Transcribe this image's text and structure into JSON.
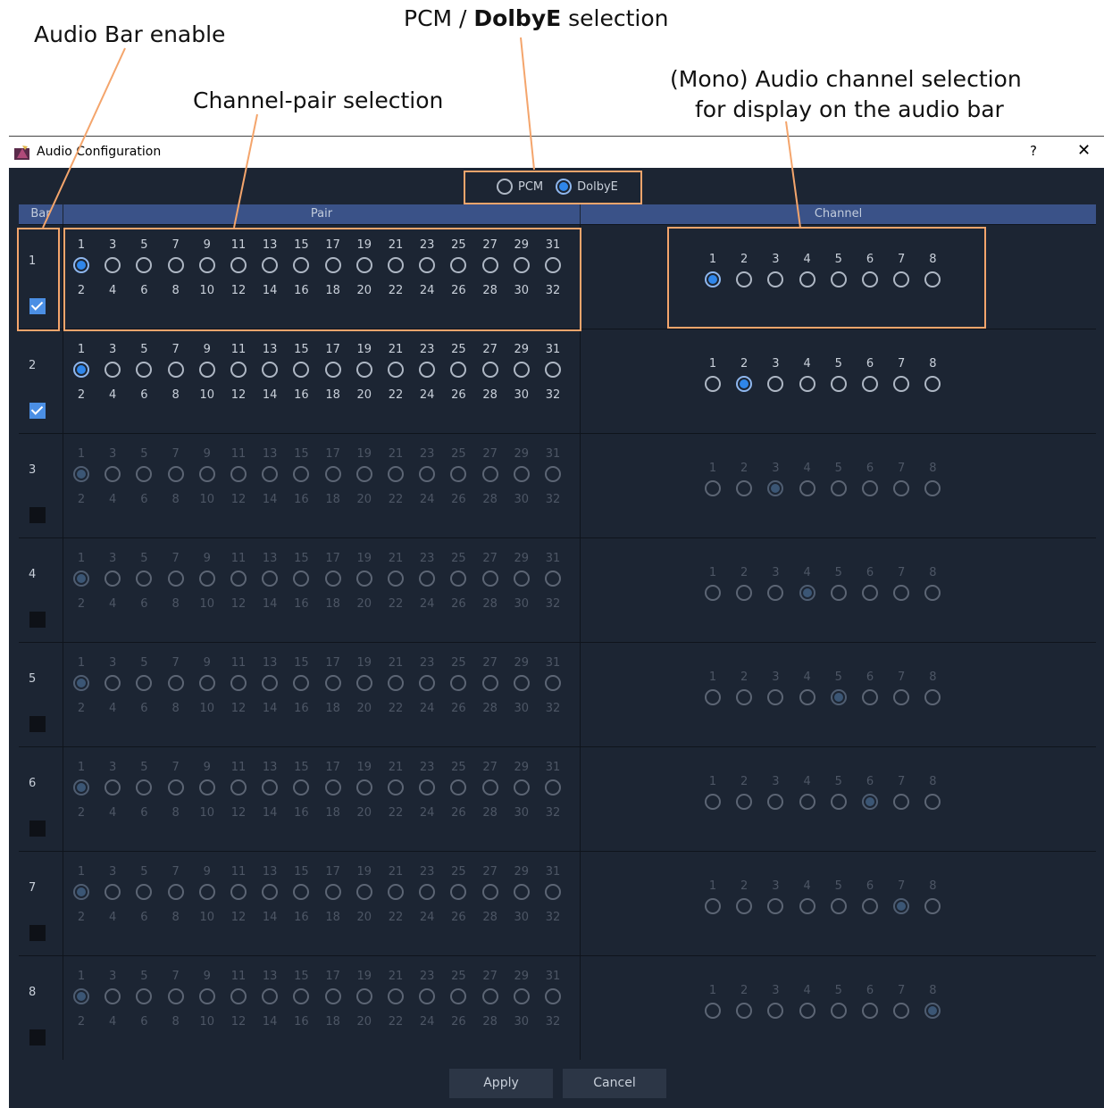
{
  "callouts": {
    "audio_bar_enable": "Audio Bar enable",
    "pcm_prefix": "PCM / ",
    "pcm_bold": "DolbyE",
    "pcm_suffix": " selection",
    "channel_pair": "Channel-pair selection",
    "mono_line1": "(Mono) Audio channel selection",
    "mono_line2": "for display on the audio bar"
  },
  "window": {
    "title": "Audio Configuration",
    "help": "?",
    "close": "✕"
  },
  "mode": {
    "options": [
      "PCM",
      "DolbyE"
    ],
    "selected": "DolbyE"
  },
  "headers": {
    "bar": "Bar",
    "pair": "Pair",
    "channel": "Channel"
  },
  "pair_top_labels": [
    "1",
    "3",
    "5",
    "7",
    "9",
    "11",
    "13",
    "15",
    "17",
    "19",
    "21",
    "23",
    "25",
    "27",
    "29",
    "31"
  ],
  "pair_bottom_labels": [
    "2",
    "4",
    "6",
    "8",
    "10",
    "12",
    "14",
    "16",
    "18",
    "20",
    "22",
    "24",
    "26",
    "28",
    "30",
    "32"
  ],
  "channel_labels": [
    "1",
    "2",
    "3",
    "4",
    "5",
    "6",
    "7",
    "8"
  ],
  "rows": [
    {
      "bar": "1",
      "enabled": true,
      "pair_selected": 1,
      "channel_selected": 1
    },
    {
      "bar": "2",
      "enabled": true,
      "pair_selected": 1,
      "channel_selected": 2
    },
    {
      "bar": "3",
      "enabled": false,
      "pair_selected": 1,
      "channel_selected": 3
    },
    {
      "bar": "4",
      "enabled": false,
      "pair_selected": 1,
      "channel_selected": 4
    },
    {
      "bar": "5",
      "enabled": false,
      "pair_selected": 1,
      "channel_selected": 5
    },
    {
      "bar": "6",
      "enabled": false,
      "pair_selected": 1,
      "channel_selected": 6
    },
    {
      "bar": "7",
      "enabled": false,
      "pair_selected": 1,
      "channel_selected": 7
    },
    {
      "bar": "8",
      "enabled": false,
      "pair_selected": 1,
      "channel_selected": 8
    }
  ],
  "buttons": {
    "apply": "Apply",
    "cancel": "Cancel"
  },
  "colors": {
    "accent": "#2f86ea",
    "highlight": "#f4a56c",
    "background": "#1c2533",
    "header": "#3a5288"
  }
}
